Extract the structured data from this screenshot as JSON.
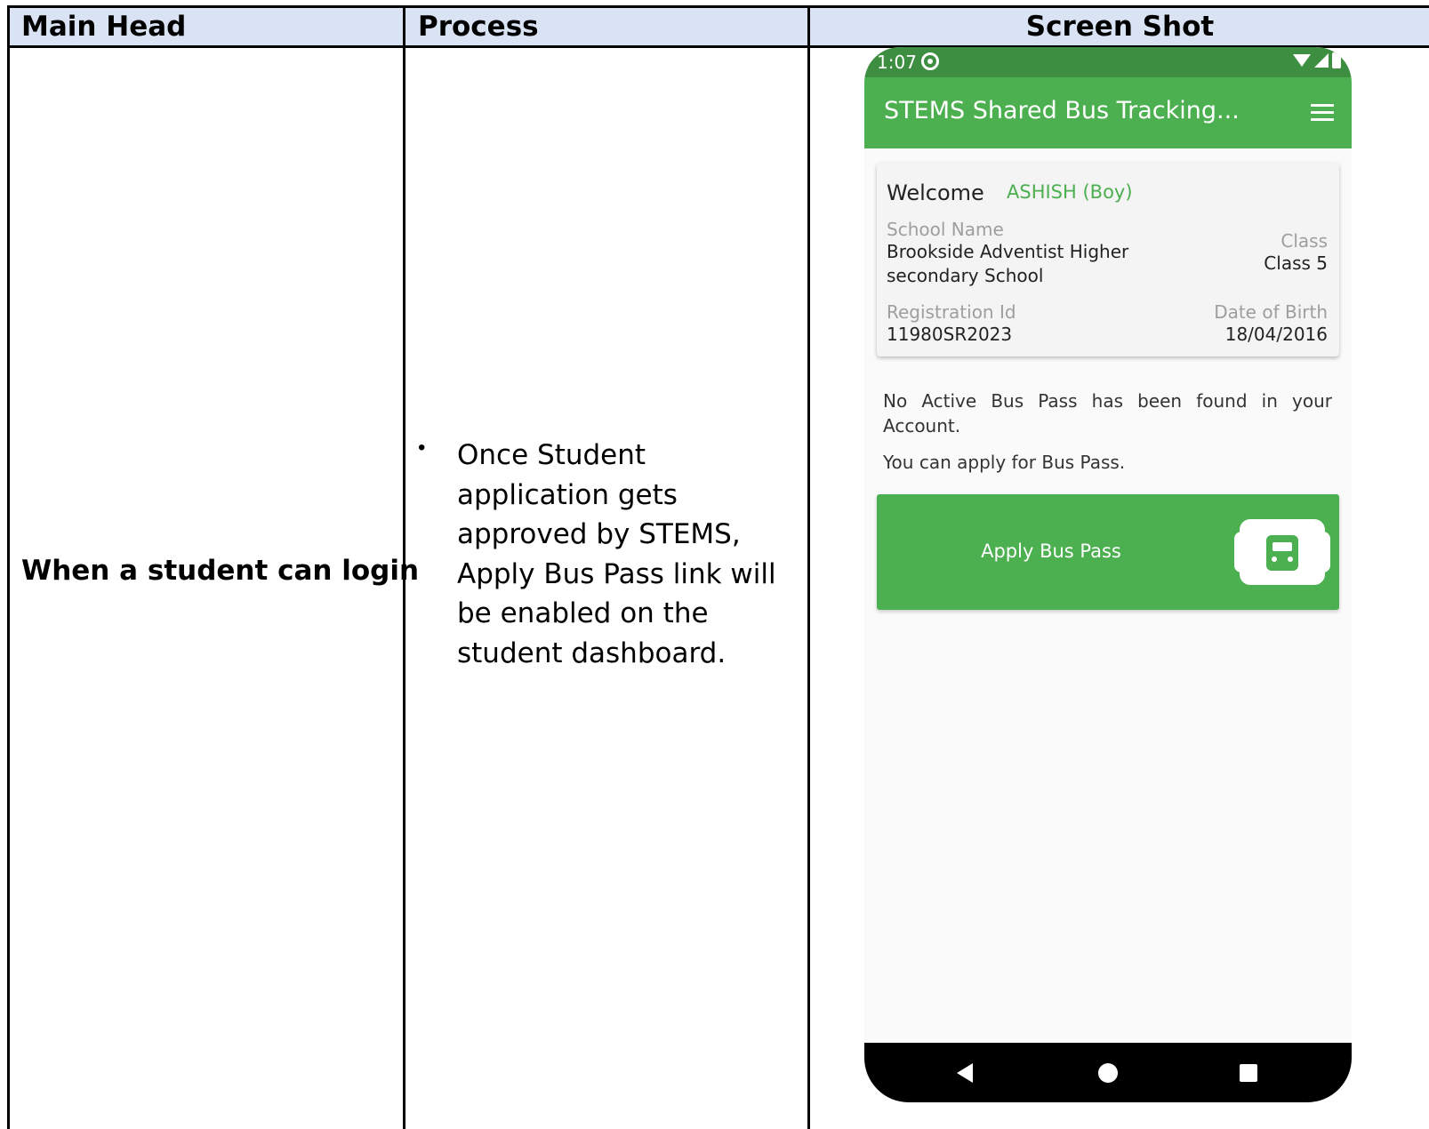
{
  "table": {
    "headers": [
      "Main Head",
      "Process",
      "Screen Shot"
    ],
    "main_head": "When a student can login",
    "process_bullet": "•",
    "process_text": "Once Student application gets approved by STEMS, Apply Bus Pass link will be enabled on the student dashboard."
  },
  "phone": {
    "status_time": "1:07",
    "app_title": "STEMS Shared Bus Tracking...",
    "card": {
      "welcome_label": "Welcome",
      "student_name": "ASHISH (Boy)",
      "school_name_label": "School Name",
      "school_name_line1": "Brookside Adventist Higher",
      "school_name_line2": "secondary School",
      "class_label": "Class",
      "class_value": "Class 5",
      "registration_label": "Registration Id",
      "registration_value": "11980SR2023",
      "dob_label": "Date of Birth",
      "dob_value": "18/04/2016"
    },
    "notice_line": "No Active Bus Pass has been found in your Account.",
    "notice_apply": "You can apply for Bus Pass.",
    "apply_button_label": "Apply Bus Pass"
  },
  "colors": {
    "header_bg": "#dae3f3",
    "app_green": "#4caf50",
    "status_green": "#3e8e41"
  }
}
